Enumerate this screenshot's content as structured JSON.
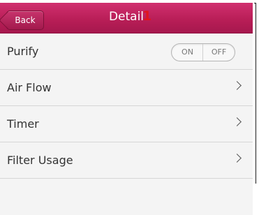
{
  "header": {
    "title": "Detail",
    "back_label": "Back"
  },
  "rows": [
    {
      "label": "Purify",
      "type": "toggle",
      "toggle": {
        "on_label": "ON",
        "off_label": "OFF"
      }
    },
    {
      "label": "Air Flow",
      "type": "chevron",
      "icon": "chevron-right-icon"
    },
    {
      "label": "Timer",
      "type": "chevron",
      "icon": "chevron-right-icon"
    },
    {
      "label": "Filter Usage",
      "type": "chevron",
      "icon": "chevron-right-icon"
    }
  ],
  "annotation": {
    "marker_text": "1",
    "color": "#e1141d"
  },
  "colors": {
    "header_accent": "#b81e57",
    "row_bg": "#f4f4f4"
  }
}
